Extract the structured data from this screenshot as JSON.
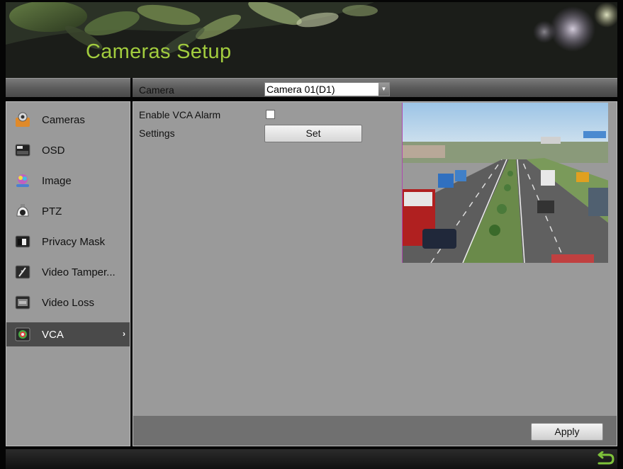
{
  "header": {
    "title": "Cameras Setup"
  },
  "toolbar": {
    "camera_label": "Camera",
    "camera_select_value": "Camera 01(D1)"
  },
  "sidebar": {
    "items": [
      {
        "label": "Cameras",
        "icon": "camera-icon"
      },
      {
        "label": "OSD",
        "icon": "osd-icon"
      },
      {
        "label": "Image",
        "icon": "image-icon"
      },
      {
        "label": "PTZ",
        "icon": "ptz-icon"
      },
      {
        "label": "Privacy Mask",
        "icon": "privacy-mask-icon"
      },
      {
        "label": "Video Tamper...",
        "icon": "video-tamper-icon"
      },
      {
        "label": "Video Loss",
        "icon": "video-loss-icon"
      },
      {
        "label": "VCA",
        "icon": "vca-icon",
        "active": true
      }
    ]
  },
  "main": {
    "enable_vca_label": "Enable VCA Alarm",
    "enable_vca_checked": false,
    "settings_label": "Settings",
    "set_button_label": "Set",
    "apply_button_label": "Apply"
  },
  "colors": {
    "title_green": "#a2cc3e",
    "panel_gray": "#9a9a9a",
    "active_item": "#4a4a4a"
  }
}
